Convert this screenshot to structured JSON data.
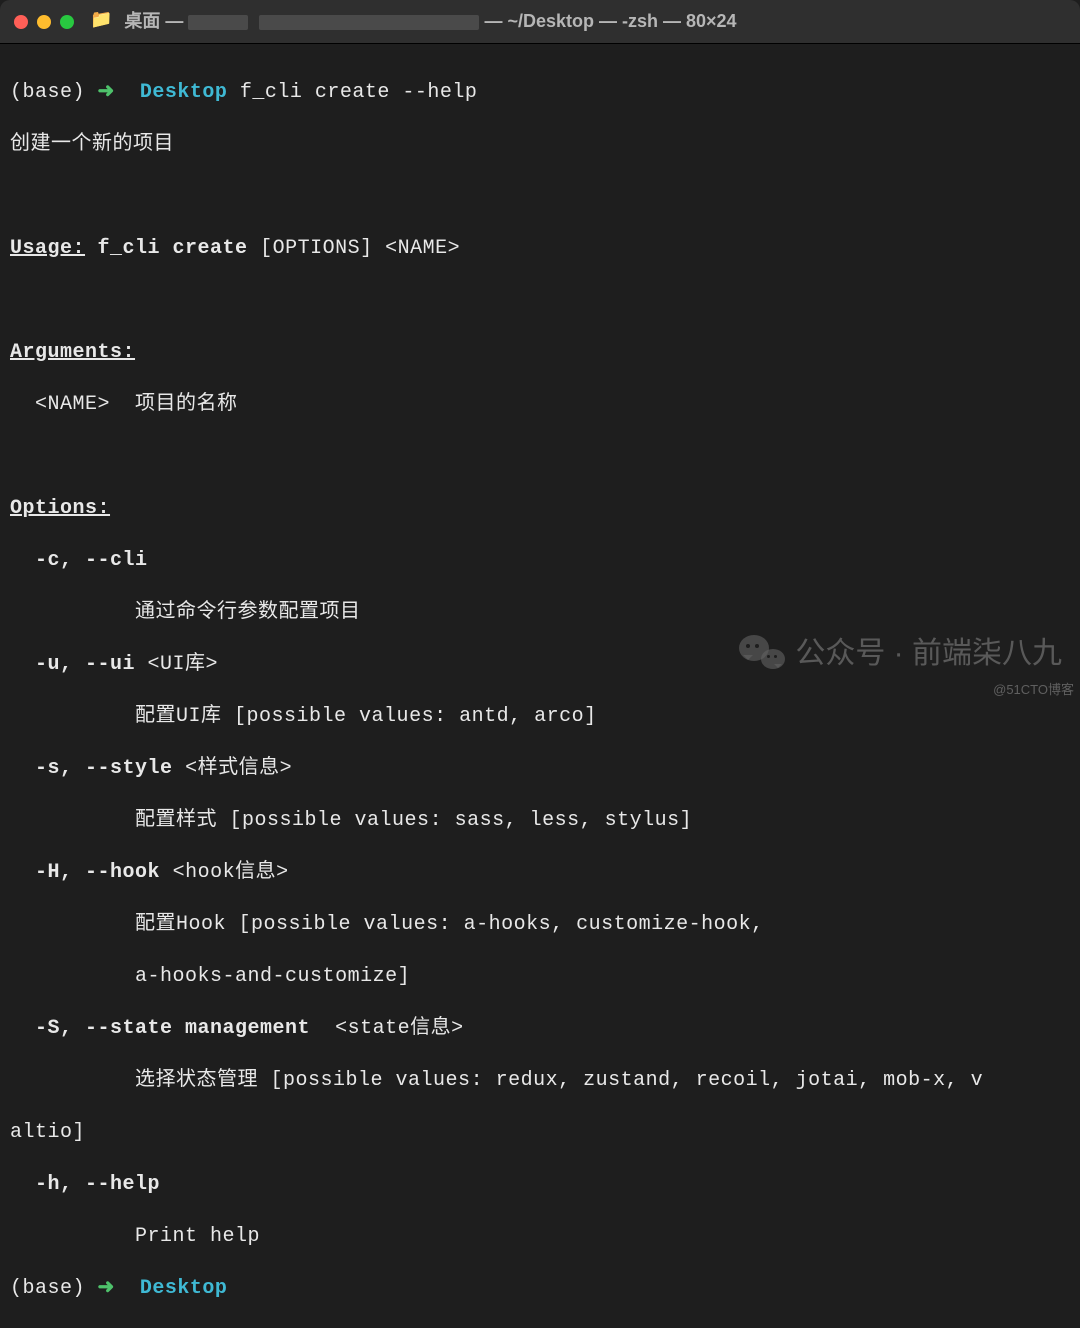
{
  "window": {
    "title_prefix": "桌面 —",
    "title_suffix": "— ~/Desktop — -zsh — 80×24"
  },
  "prompt": {
    "base": "(base)",
    "arrow": "➜",
    "dir": "Desktop",
    "command": "f_cli create --help"
  },
  "help": {
    "description": "创建一个新的项目",
    "usage_label": "Usage:",
    "usage_cmd": "f_cli create",
    "usage_args": "[OPTIONS] <NAME>",
    "arguments_label": "Arguments:",
    "arguments": {
      "name_flag": "<NAME>",
      "name_desc": "项目的名称"
    },
    "options_label": "Options:",
    "options": {
      "cli": {
        "flags": "-c, --cli",
        "desc": "通过命令行参数配置项目"
      },
      "ui": {
        "flags": "-u, --ui",
        "meta": "<UI库>",
        "desc": "配置UI库 [possible values: antd, arco]"
      },
      "style": {
        "flags": "-s, --style",
        "meta": "<样式信息>",
        "desc": "配置样式 [possible values: sass, less, stylus]"
      },
      "hook": {
        "flags": "-H, --hook",
        "meta": "<hook信息>",
        "desc1": "配置Hook [possible values: a-hooks, customize-hook,",
        "desc2": "a-hooks-and-customize]"
      },
      "state": {
        "flags": "-S, --state management",
        "meta": "<state信息>",
        "desc1": "选择状态管理 [possible values: redux, zustand, recoil, jotai, mob-x, v",
        "desc2": "altio]"
      },
      "helpopt": {
        "flags": "-h, --help",
        "desc": "Print help"
      }
    }
  },
  "prompt2": {
    "base": "(base)",
    "arrow": "➜",
    "dir": "Desktop"
  },
  "watermark": {
    "text": "公众号 · 前端柒八九"
  },
  "attribution": "@51CTO博客"
}
